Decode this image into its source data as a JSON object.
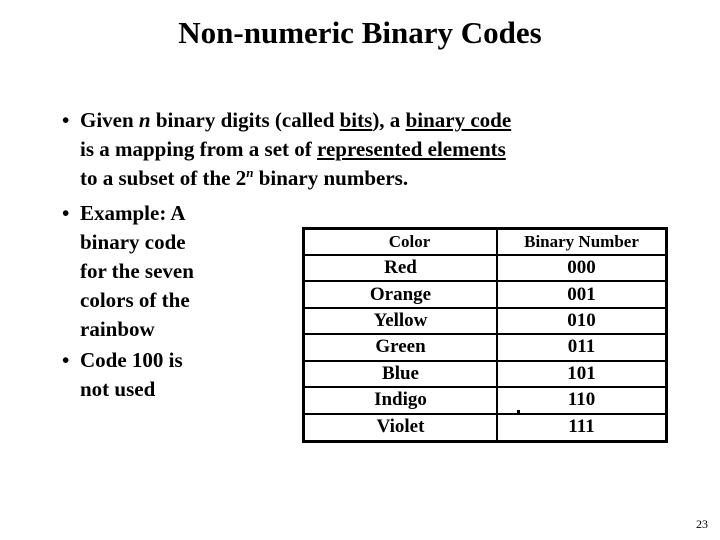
{
  "slide": {
    "title": "Non-numeric Binary Codes",
    "page_number": "23",
    "background_color": "#ffffff",
    "text_color": "#000000"
  },
  "bullets": [
    {
      "marker": "•",
      "lines": [
        {
          "segments": [
            {
              "text": "Given ",
              "style": "normal"
            },
            {
              "text": "n",
              "style": "italic"
            },
            {
              "text": " binary digits (called ",
              "style": "normal"
            },
            {
              "text": "bits",
              "style": "underline"
            },
            {
              "text": "), a ",
              "style": "normal"
            },
            {
              "text": "binary code",
              "style": "underline"
            }
          ]
        },
        {
          "segments": [
            {
              "text": "is a mapping from a set of ",
              "style": "normal"
            },
            {
              "text": "represented elements",
              "style": "underline"
            }
          ]
        },
        {
          "segments": [
            {
              "text": "to a subset of the 2",
              "style": "normal"
            },
            {
              "text": "n",
              "style": "superscript-italic"
            },
            {
              "text": " binary numbers.",
              "style": "normal"
            }
          ]
        }
      ]
    },
    {
      "marker": "•",
      "lines": [
        {
          "segments": [
            {
              "text": "Example: A",
              "style": "normal"
            }
          ]
        },
        {
          "segments": [
            {
              "text": "binary code",
              "style": "normal"
            }
          ]
        },
        {
          "segments": [
            {
              "text": "for the seven",
              "style": "normal"
            }
          ]
        },
        {
          "segments": [
            {
              "text": "colors of the",
              "style": "normal"
            }
          ]
        },
        {
          "segments": [
            {
              "text": "rainbow",
              "style": "normal"
            }
          ]
        }
      ]
    },
    {
      "marker": "•",
      "lines": [
        {
          "segments": [
            {
              "text": "Code 100 is",
              "style": "normal"
            }
          ]
        },
        {
          "segments": [
            {
              "text": "not used",
              "style": "normal"
            }
          ]
        }
      ]
    }
  ],
  "table": {
    "headers": [
      "Color",
      "Binary Number"
    ],
    "rows": [
      [
        "Red",
        "000"
      ],
      [
        "Orange",
        "001"
      ],
      [
        "Yellow",
        "010"
      ],
      [
        "Green",
        "011"
      ],
      [
        "Blue",
        "101"
      ],
      [
        "Indigo",
        "110"
      ],
      [
        "Violet",
        "111"
      ]
    ]
  }
}
